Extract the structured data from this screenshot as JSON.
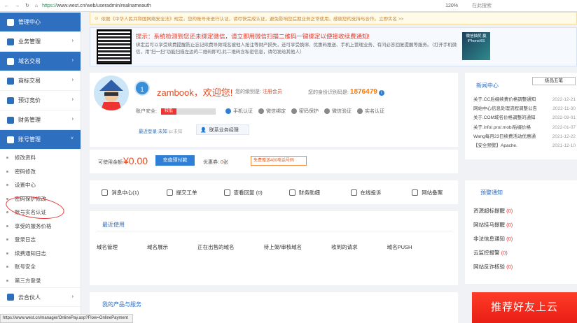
{
  "browser": {
    "url_scheme": "https://",
    "url_rest": "www.west.cn/web/useradmin/realnameauth",
    "zoom": "120%",
    "search_placeholder": "在此搜索"
  },
  "sidebar": {
    "items": [
      {
        "label": "管理中心",
        "active": false
      },
      {
        "label": "业务管理",
        "active": false
      },
      {
        "label": "域名交易",
        "active": true
      },
      {
        "label": "商标交易",
        "active": false
      },
      {
        "label": "预订竞价",
        "active": false
      },
      {
        "label": "财务管理",
        "active": false
      },
      {
        "label": "账号管理",
        "active": true
      }
    ],
    "subitems": [
      "修改资料",
      "密码修改",
      "设置中心",
      "密码保护修改",
      "账号实名认证",
      "享受的服务价格",
      "登录日志",
      "续费通知日志",
      "账号安全",
      "第三方登录"
    ],
    "bottom": "云合伙人"
  },
  "notice": "依据《中华人民共和国网络安全法》规定，您的账号未进行认证，请尽快完成认证，避免影响您后期业务正常使用，感谢您的支持与合作。立即实名 >>",
  "alert": {
    "title": "提示：系统检测到您还未绑定微信，请立即用微信扫描二维码一键绑定以便接收续费通知!",
    "text": "绑定后可以享受续费提醒防止忘记续费导致域名被他人抢注等财产损失，还可享受换绑、优惠码推送、手机上管理业务、有问必答回复提醒等服务。（打开手机微信，用\"扫一扫\"功能扫描左边的二维码即可,此二维码含私密信息，请勿发给其他人）",
    "phone": "微信抽奖 赢iPhoneXS"
  },
  "profile": {
    "vip": "1",
    "welcome": "zambook，欢迎您!",
    "level_label": "您的级别是:",
    "level": "注册会员",
    "code_label": "您的身份识别码是:",
    "code": "1876479",
    "security_label": "账户安全:",
    "security_level": "较低",
    "security_fraction": 0.28,
    "badges": [
      "手机认证",
      "微信绑定",
      "密码保护",
      "微信验证",
      "实名认证"
    ],
    "login_label": "最近登录:",
    "login_value": "未知",
    "ip_label": "ip:未知",
    "manager": "联系业务经理"
  },
  "balance": {
    "label": "可使用金额:",
    "value": "¥0.00",
    "pay_button": "充值预付款",
    "coupon_label": "优惠券:",
    "coupon_value": "0",
    "coupon_unit": "张",
    "sms": "免费赠送400电话号码"
  },
  "quick": [
    "消息中心(1)",
    "提交工单",
    "查看回复 (0)",
    "财务助细",
    "在线投诉",
    "网站备案"
  ],
  "recent": {
    "tab": "最近使用",
    "cols": [
      "域名管理",
      "域名展示",
      "正在出售的域名",
      "待上架/审核域名",
      "收到的请求",
      "域名PUSH"
    ]
  },
  "products": {
    "tab": "我的产品与服务"
  },
  "news": {
    "title": "新闻中心",
    "tab": "极品五笔",
    "rows": [
      {
        "t": "关于.CC后缀续费价格调整通知",
        "d": "2022-12-21"
      },
      {
        "t": "网站中心信息处理流程调整公告",
        "d": "2022-11-30"
      },
      {
        "t": "关于.COM域名价格调整的通知",
        "d": "2022-09-01"
      },
      {
        "t": "关于.info/.pro/.mobi后缀价格",
        "d": "2022-01-07"
      },
      {
        "t": "Wang每月23日续费活动优惠通",
        "d": "2021-12-22"
      },
      {
        "t": "【安全预警】Apache.",
        "d": "2021-12-10"
      }
    ]
  },
  "alerts": {
    "title": "预警通知",
    "rows": [
      {
        "label": "资源超标提醒",
        "count": "(0)"
      },
      {
        "label": "网站挂马提醒",
        "count": "(0)"
      },
      {
        "label": "非法信息通知",
        "count": "(0)"
      },
      {
        "label": "云监控报警",
        "count": "(0)"
      },
      {
        "label": "网站反诈核验",
        "count": "(0)"
      }
    ]
  },
  "promo": "推荐好友上云",
  "status_url": "https://www.west.cn/manager/OnlinePay.asp?Flow=OnlinePayment"
}
